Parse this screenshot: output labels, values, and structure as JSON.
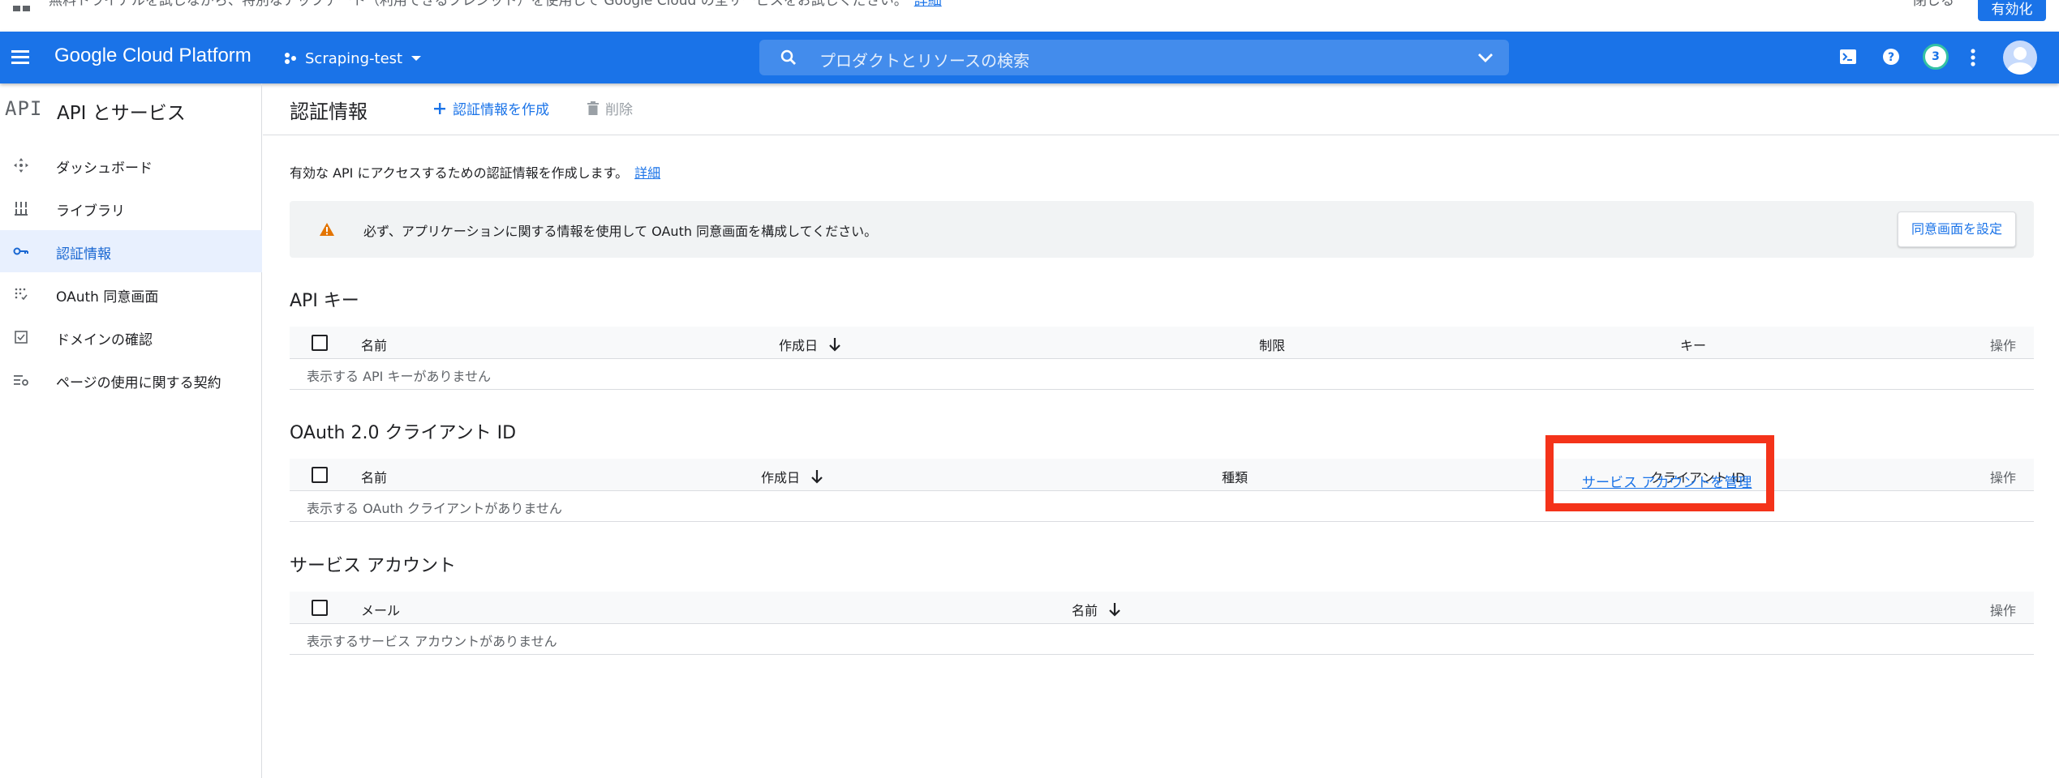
{
  "notice": {
    "text": "無料トライアルを試しながら、特別なアップデート（利用できるクレジット）を使用して Google Cloud の全サービスをお試しください。",
    "link": "詳細",
    "dismiss": "閉じる",
    "enable": "有効化"
  },
  "header": {
    "brand": "Google Cloud Platform",
    "project": "Scraping-test",
    "search_placeholder": "プロダクトとリソースの検索",
    "notification_count": "3"
  },
  "sidebar": {
    "api_logo": "API",
    "title": "API とサービス",
    "items": [
      {
        "label": "ダッシュボード"
      },
      {
        "label": "ライブラリ"
      },
      {
        "label": "認証情報"
      },
      {
        "label": "OAuth 同意画面"
      },
      {
        "label": "ドメインの確認"
      },
      {
        "label": "ページの使用に関する契約"
      }
    ]
  },
  "toolbar": {
    "title": "認証情報",
    "create_label": "認証情報を作成",
    "delete_label": "削除"
  },
  "intro": {
    "text": "有効な API にアクセスするための認証情報を作成します。",
    "link": "詳細"
  },
  "warning": {
    "text": "必ず、アプリケーションに関する情報を使用して OAuth 同意画面を構成してください。",
    "button": "同意画面を設定"
  },
  "api_keys": {
    "title": "API キー",
    "columns": [
      "名前",
      "作成日",
      "制限",
      "キー",
      "操作"
    ],
    "empty": "表示する API キーがありません"
  },
  "oauth": {
    "title": "OAuth 2.0 クライアント ID",
    "columns": [
      "名前",
      "作成日",
      "種類",
      "クライアント ID",
      "操作"
    ],
    "empty": "表示する OAuth クライアントがありません"
  },
  "service_accounts": {
    "title": "サービス アカウント",
    "manage_link": "サービス アカウントを管理",
    "columns": [
      "メール",
      "名前",
      "操作"
    ],
    "empty": "表示するサービス アカウントがありません"
  },
  "colors": {
    "header_bg": "#1a73e8",
    "link": "#1a73e8",
    "active_bg": "#e8f0fe",
    "warning_icon": "#e37400",
    "highlight": "#f4331a"
  },
  "icons": {
    "menu": "menu-icon",
    "project": "project-icon",
    "search": "search-icon",
    "terminal": "cloud-shell-icon",
    "help": "help-icon",
    "more": "more-vert-icon",
    "warning": "warning-icon"
  }
}
